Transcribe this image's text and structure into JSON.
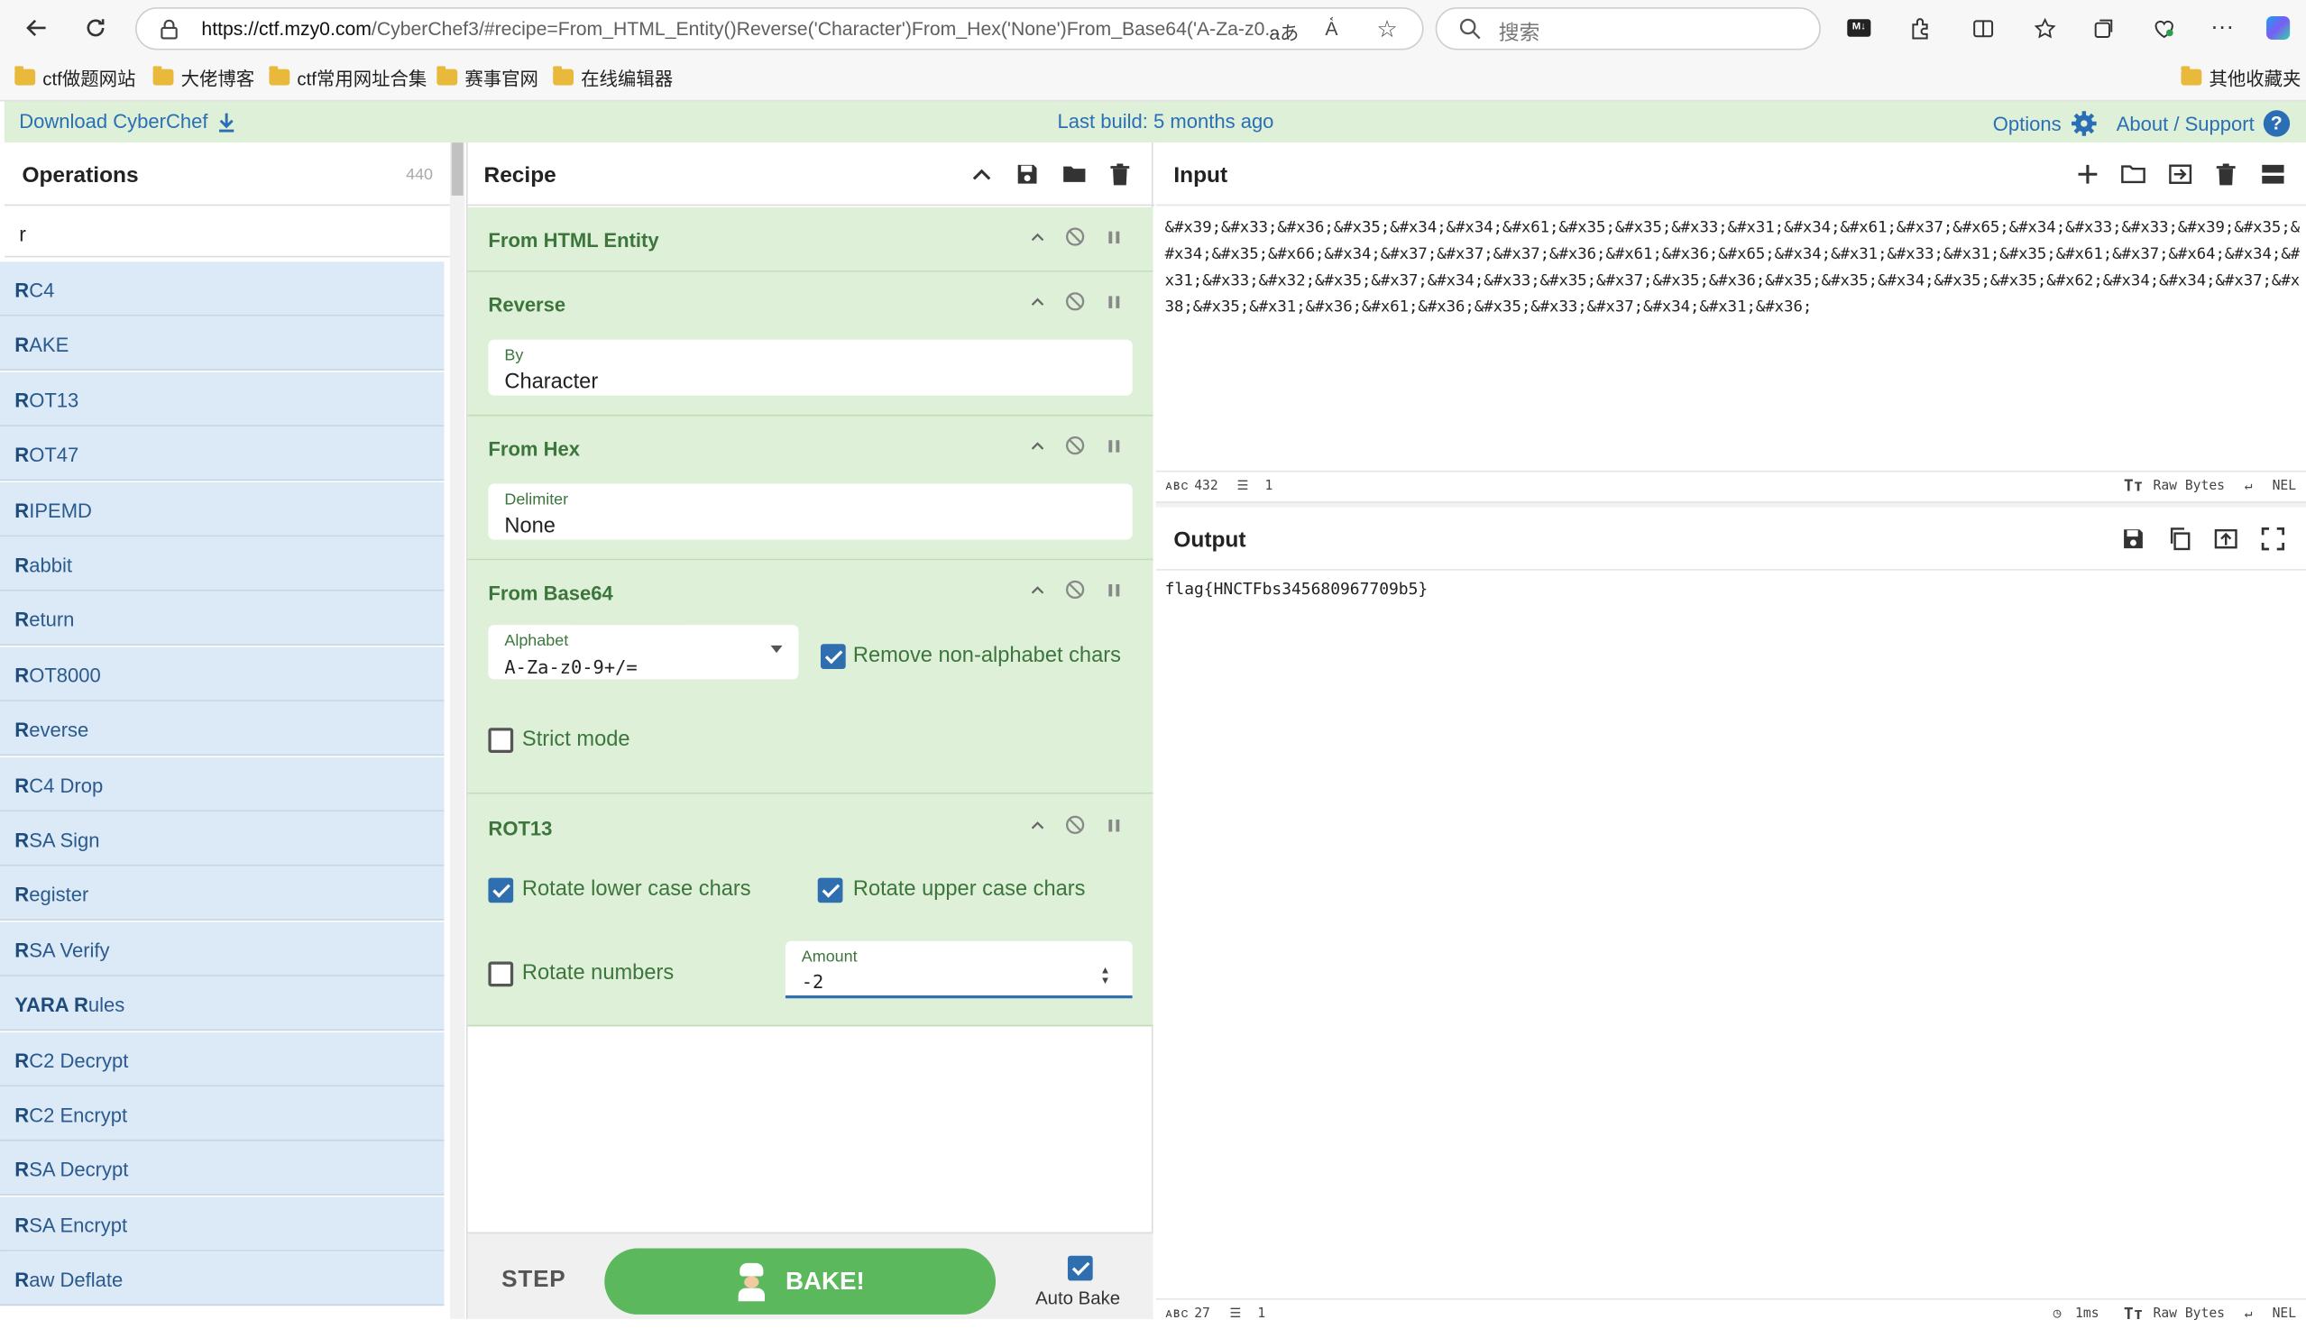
{
  "browser": {
    "url_host": "https://ctf.mzy0.com",
    "url_rest": "/CyberChef3/#recipe=From_HTML_Entity()Reverse('Character')From_Hex('None')From_Base64('A-Za-z0...",
    "search_placeholder": "搜索",
    "bookmarks": [
      "ctf做题网站",
      "大佬博客",
      "ctf常用网址合集",
      "赛事官网",
      "在线编辑器"
    ],
    "other_bookmarks": "其他收藏夹"
  },
  "banner": {
    "download": "Download CyberChef",
    "last_build": "Last build: 5 months ago",
    "options": "Options",
    "about": "About / Support"
  },
  "operations": {
    "title": "Operations",
    "count": "440",
    "search_value": "r",
    "items": [
      {
        "first": "R",
        "rest": "C4"
      },
      {
        "first": "R",
        "rest": "AKE"
      },
      {
        "first": "R",
        "rest": "OT13"
      },
      {
        "first": "R",
        "rest": "OT47"
      },
      {
        "first": "R",
        "rest": "IPEMD"
      },
      {
        "first": "R",
        "rest": "abbit"
      },
      {
        "first": "R",
        "rest": "eturn"
      },
      {
        "first": "R",
        "rest": "OT8000"
      },
      {
        "first": "R",
        "rest": "everse"
      },
      {
        "first": "R",
        "rest": "C4 Drop"
      },
      {
        "first": "R",
        "rest": "SA Sign"
      },
      {
        "first": "R",
        "rest": "egister"
      },
      {
        "first": "R",
        "rest": "SA Verify"
      },
      {
        "first": "YARA R",
        "rest": "ules"
      },
      {
        "first": "R",
        "rest": "C2 Decrypt"
      },
      {
        "first": "R",
        "rest": "C2 Encrypt"
      },
      {
        "first": "R",
        "rest": "SA Decrypt"
      },
      {
        "first": "R",
        "rest": "SA Encrypt"
      },
      {
        "first": "R",
        "rest": "aw Deflate"
      }
    ]
  },
  "recipe": {
    "title": "Recipe",
    "from_html": {
      "title": "From HTML Entity"
    },
    "reverse": {
      "title": "Reverse",
      "by_label": "By",
      "by_value": "Character"
    },
    "from_hex": {
      "title": "From Hex",
      "delim_label": "Delimiter",
      "delim_value": "None"
    },
    "from_base64": {
      "title": "From Base64",
      "alpha_label": "Alphabet",
      "alpha_value": "A-Za-z0-9+/=",
      "remove_label": "Remove non-alphabet chars",
      "strict_label": "Strict mode"
    },
    "rot13": {
      "title": "ROT13",
      "lower_label": "Rotate lower case chars",
      "upper_label": "Rotate upper case chars",
      "numbers_label": "Rotate numbers",
      "amount_label": "Amount",
      "amount_value": "-2"
    },
    "step": "STEP",
    "bake": "BAKE!",
    "autobake": "Auto Bake"
  },
  "input": {
    "title": "Input",
    "text": "&#x39;&#x33;&#x36;&#x35;&#x34;&#x34;&#x61;&#x35;&#x35;&#x33;&#x31;&#x34;&#x61;&#x37;&#x65;&#x34;&#x33;&#x33;&#x39;&#x35;&#x34;&#x35;&#x66;&#x34;&#x37;&#x37;&#x37;&#x36;&#x61;&#x36;&#x65;&#x34;&#x31;&#x33;&#x31;&#x35;&#x61;&#x37;&#x64;&#x34;&#x31;&#x33;&#x32;&#x35;&#x37;&#x34;&#x33;&#x35;&#x37;&#x35;&#x36;&#x35;&#x35;&#x34;&#x35;&#x35;&#x62;&#x34;&#x34;&#x37;&#x38;&#x35;&#x31;&#x36;&#x61;&#x36;&#x35;&#x33;&#x37;&#x34;&#x31;&#x36;",
    "chars": "432",
    "lines": "1",
    "raw_bytes": "Raw Bytes",
    "eol": "NEL"
  },
  "output": {
    "title": "Output",
    "text": "flag{HNCTFbs345680967709b5}",
    "chars": "27",
    "lines": "1",
    "time": "1ms",
    "raw_bytes": "Raw Bytes",
    "eol": "NEL"
  }
}
